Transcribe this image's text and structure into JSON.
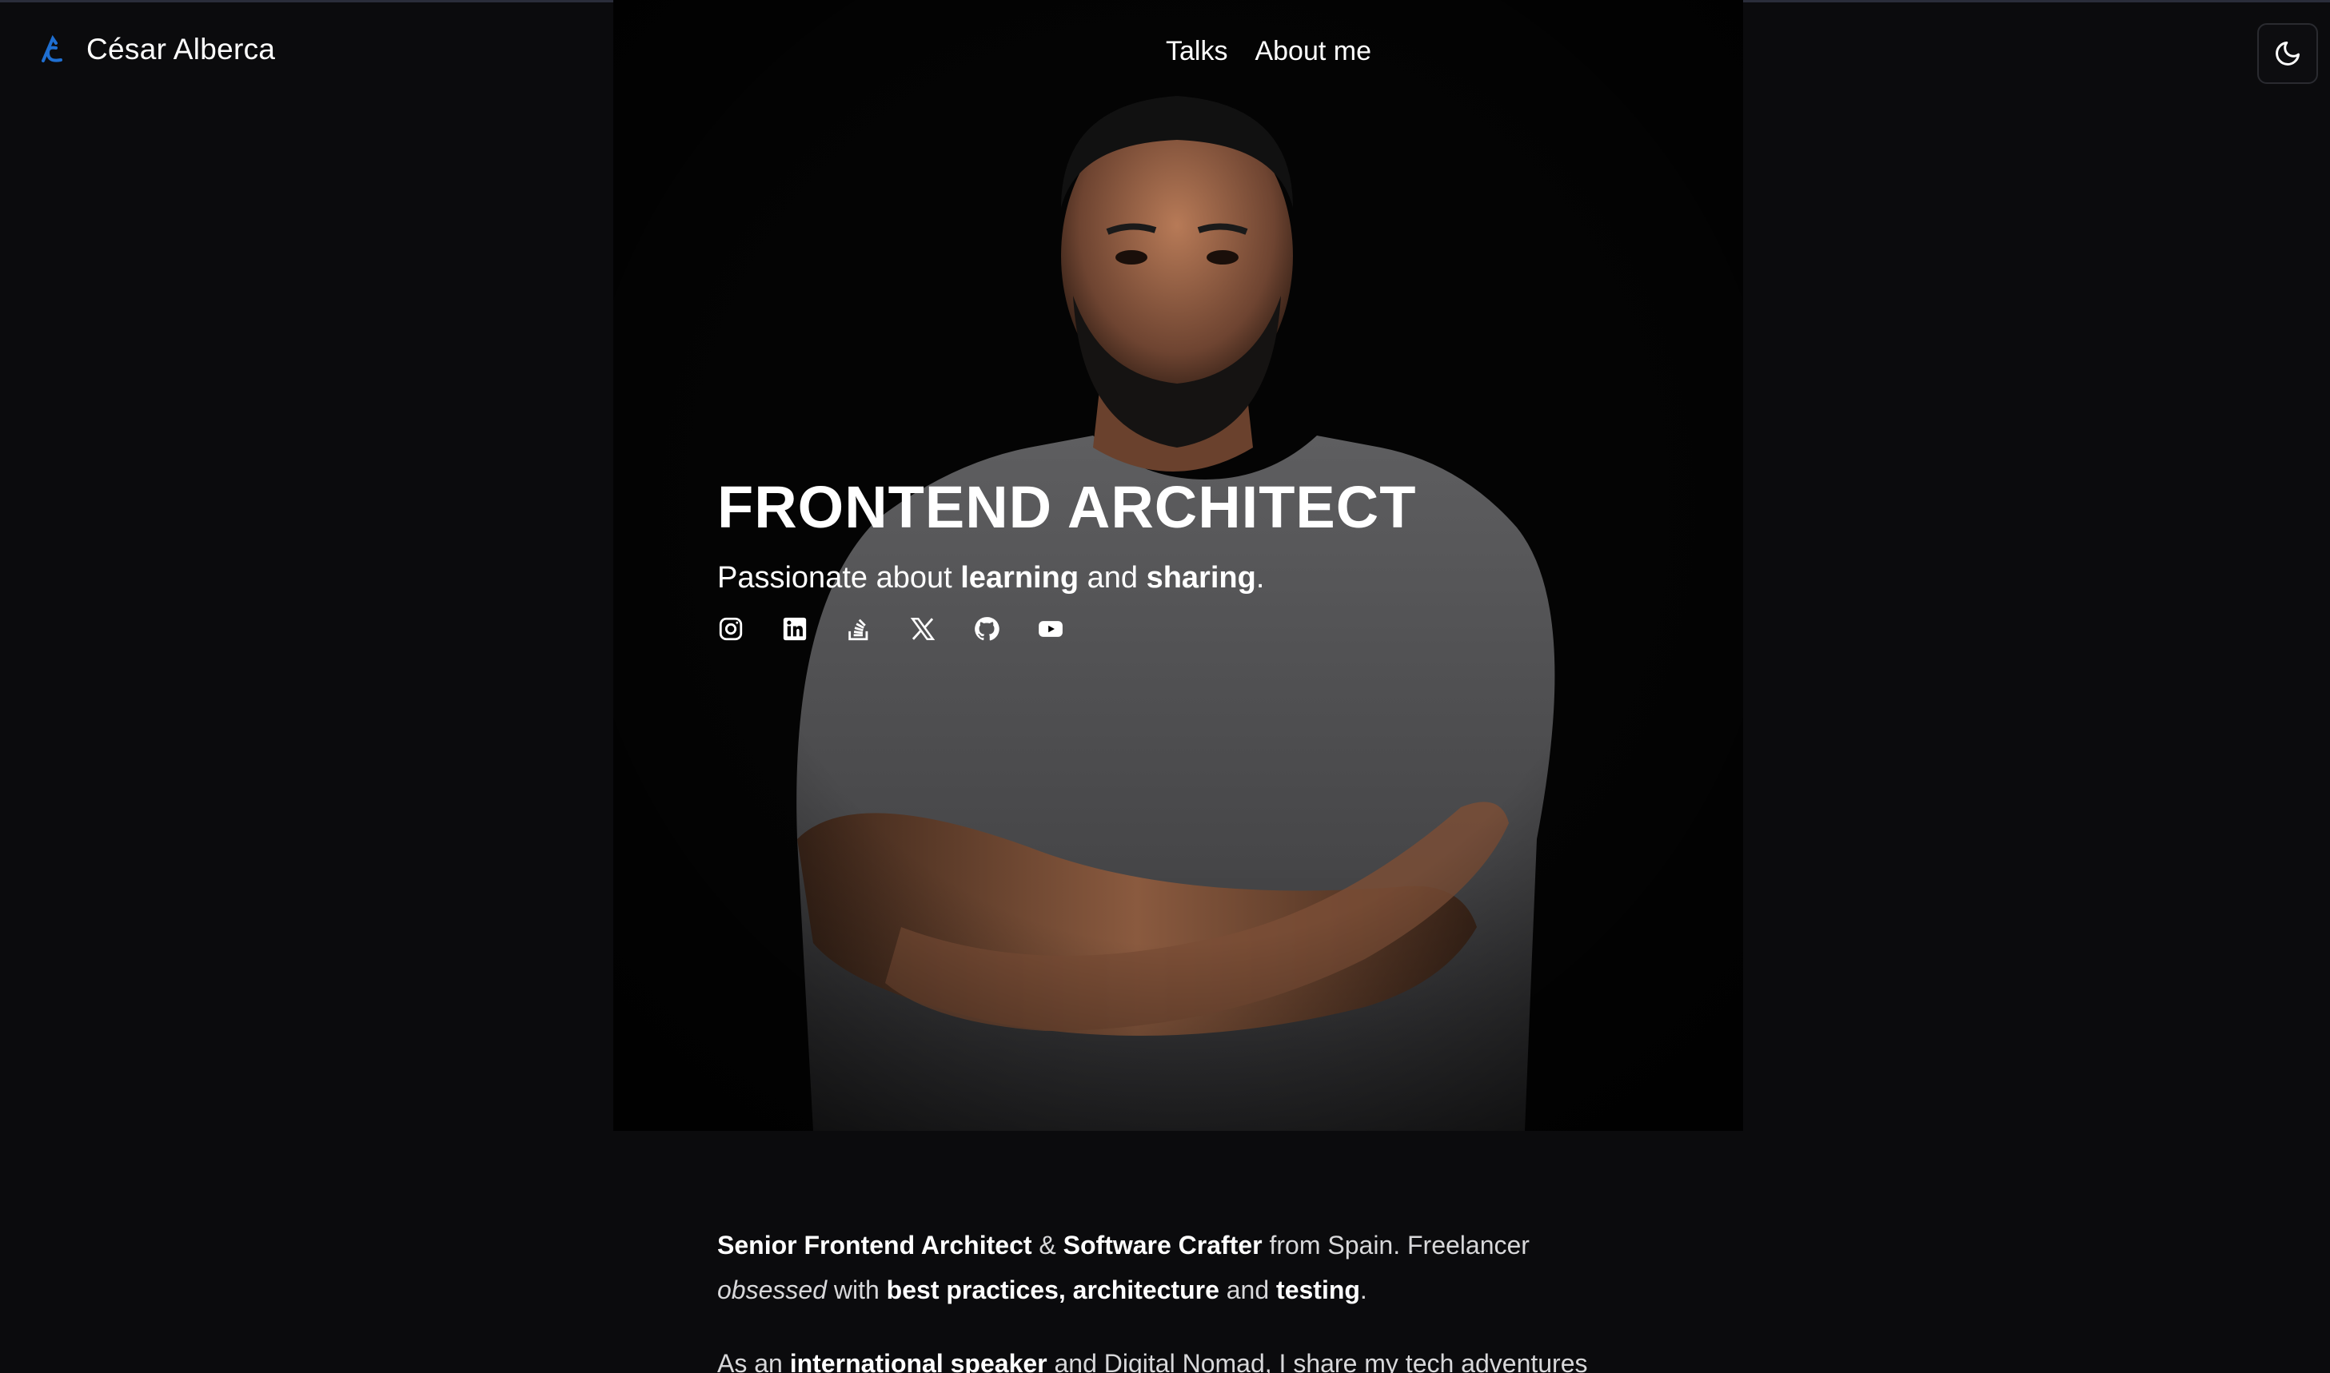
{
  "header": {
    "brand_name": "César Alberca",
    "nav": [
      "Talks",
      "About me"
    ],
    "theme_toggle_icon": "moon-icon"
  },
  "hero": {
    "title": "FRONTEND ARCHITECT",
    "subtitle": {
      "p1": "Passionate about ",
      "b1": "learning",
      "p2": " and ",
      "b2": "sharing",
      "p3": "."
    },
    "socials": [
      "instagram-icon",
      "linkedin-icon",
      "stackoverflow-icon",
      "x-icon",
      "github-icon",
      "youtube-icon"
    ]
  },
  "bio": {
    "para1": {
      "b1": "Senior Frontend Architect",
      "t1": " & ",
      "b2": "Software Crafter",
      "t2": " from Spain. Freelancer ",
      "i1": "obsessed",
      "t3": " with ",
      "b3": "best practices, architecture",
      "t4": " and ",
      "b4": "testing",
      "t5": "."
    },
    "para2": {
      "t1": "As an ",
      "b1": "international speaker",
      "t2": " and Digital Nomad, I share my tech adventures"
    }
  },
  "colors": {
    "background": "#0b0b0d",
    "accent_logo": "#1f6fd1",
    "text": "#ffffff"
  }
}
